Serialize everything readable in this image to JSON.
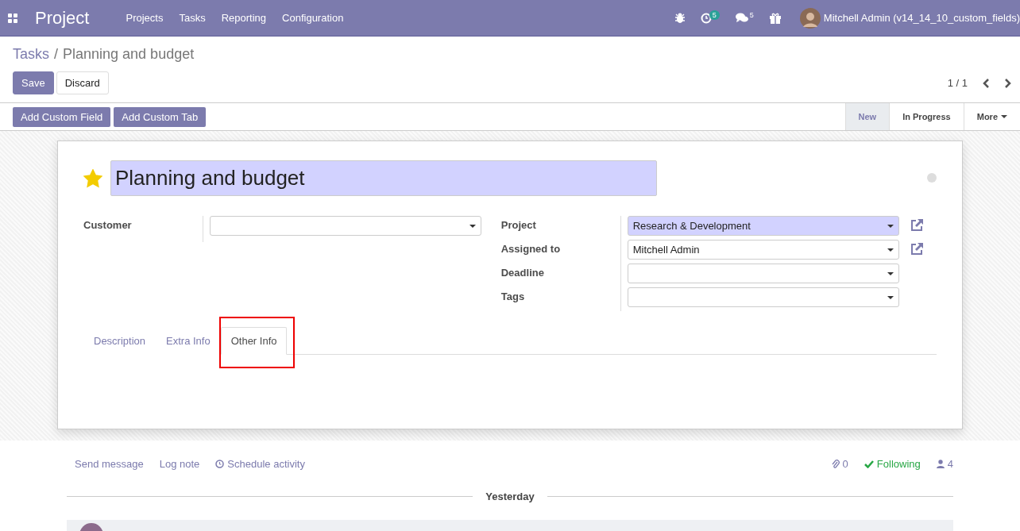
{
  "navbar": {
    "app": "Project",
    "menu": [
      "Projects",
      "Tasks",
      "Reporting",
      "Configuration"
    ],
    "activity_count": "5",
    "message_count": "5",
    "user": "Mitchell Admin (v14_14_10_custom_fields)"
  },
  "breadcrumb": {
    "parent": "Tasks",
    "separator": "/",
    "current": "Planning and budget"
  },
  "actions": [
    "Save",
    "Discard"
  ],
  "pager": "1 / 1",
  "custom_buttons": [
    "Add Custom Field",
    "Add Custom Tab"
  ],
  "stages": [
    {
      "label": "New",
      "selected": true
    },
    {
      "label": "In Progress",
      "selected": false
    },
    {
      "label": "More",
      "selected": false
    }
  ],
  "task": {
    "title": "Planning and budget",
    "starred": true
  },
  "left_fields": [
    {
      "label": "Customer",
      "highlighted": false,
      "external_link": false
    }
  ],
  "right_fields": [
    {
      "label": "Project",
      "value": "Research & Development",
      "highlighted": true,
      "external_link": true
    },
    {
      "label": "Assigned to",
      "value": "Mitchell Admin",
      "highlighted": false,
      "external_link": true
    },
    {
      "label": "Deadline",
      "highlighted": false,
      "external_link": false
    },
    {
      "label": "Tags",
      "highlighted": false,
      "external_link": false
    }
  ],
  "tabs": [
    {
      "label": "Description",
      "selected": false,
      "marked": false
    },
    {
      "label": "Extra Info",
      "selected": false,
      "marked": false
    },
    {
      "label": "Other Info",
      "selected": true,
      "marked": true
    }
  ],
  "chatter": {
    "actions": [
      "Send message",
      "Log note",
      "Schedule activity"
    ],
    "attachments": "0",
    "following": "Following",
    "followers": "4",
    "separator": "Yesterday"
  }
}
